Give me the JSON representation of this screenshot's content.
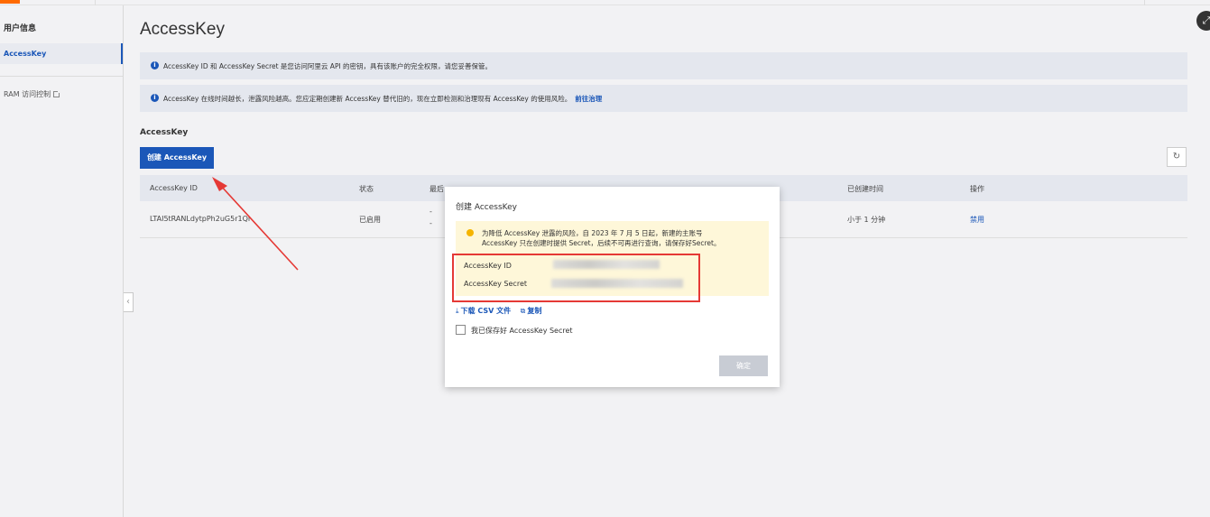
{
  "sidebar": {
    "title": "用户信息",
    "active_item": "AccessKey",
    "ram_item": "RAM 访问控制"
  },
  "main": {
    "title": "AccessKey",
    "alert1": "AccessKey ID 和 AccessKey Secret 是您访问阿里云 API 的密钥，具有该账户的完全权限，请您妥善保管。",
    "alert2": "AccessKey 在线时间越长，泄露风险越高。您应定期创建新 AccessKey 替代旧的，现在立即检测和治理现有 AccessKey 的使用风险。",
    "alert2_link": "前往治理",
    "section_title": "AccessKey",
    "create_button": "创建 AccessKey",
    "table": {
      "headers": [
        "AccessKey ID",
        "状态",
        "最后",
        "已创建时间",
        "操作"
      ],
      "rows": [
        {
          "id": "LTAI5tRANLdytpPh2uG5r1Qi",
          "status": "已启用",
          "last_used_1": "-",
          "last_used_2": "-",
          "created": "小于 1 分钟",
          "action": "禁用"
        }
      ]
    }
  },
  "modal": {
    "title": "创建 AccessKey",
    "warning_line1": "为降低 AccessKey 泄露的风险，自 2023 年 7 月 5 日起，新建的主账号",
    "warning_line2": "AccessKey 只在创建时提供 Secret，后续不可再进行查询，请保存好Secret。",
    "id_label": "AccessKey ID",
    "secret_label": "AccessKey Secret",
    "download_link": "下载 CSV 文件",
    "copy_link": "复制",
    "checkbox_label": "我已保存好 AccessKey Secret",
    "checkbox_checked": false,
    "ok_button": "确定"
  },
  "colors": {
    "accent": "#1b57b8",
    "brand": "#ff6a00",
    "warning_bg": "#fef7d9",
    "highlight": "#e53935"
  }
}
